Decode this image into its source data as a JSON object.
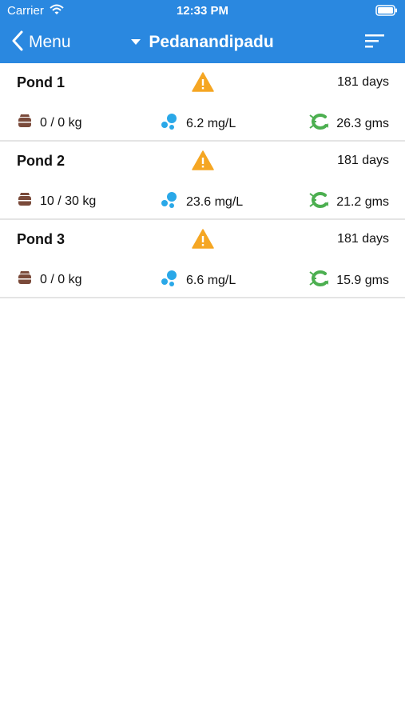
{
  "status_bar": {
    "carrier": "Carrier",
    "time": "12:33 PM"
  },
  "nav": {
    "back_label": "Menu",
    "title": "Pedanandipadu"
  },
  "ponds": [
    {
      "name": "Pond 1",
      "days": "181 days",
      "feed": "0 / 0 kg",
      "oxygen": "6.2 mg/L",
      "weight": "26.3 gms"
    },
    {
      "name": "Pond 2",
      "days": "181 days",
      "feed": "10 / 30 kg",
      "oxygen": "23.6 mg/L",
      "weight": "21.2 gms"
    },
    {
      "name": "Pond 3",
      "days": "181 days",
      "feed": "0 / 0 kg",
      "oxygen": "6.6 mg/L",
      "weight": "15.9 gms"
    }
  ],
  "icons": {
    "warning": "warning-triangle-icon",
    "feed": "feed-bag-icon",
    "oxygen": "oxygen-bubbles-icon",
    "growth": "shrimp-icon"
  },
  "colors": {
    "header": "#2a88e0",
    "warning": "#f5a623",
    "feed": "#7a4a3a",
    "oxygen": "#2aa8e8",
    "growth": "#4caf50"
  }
}
